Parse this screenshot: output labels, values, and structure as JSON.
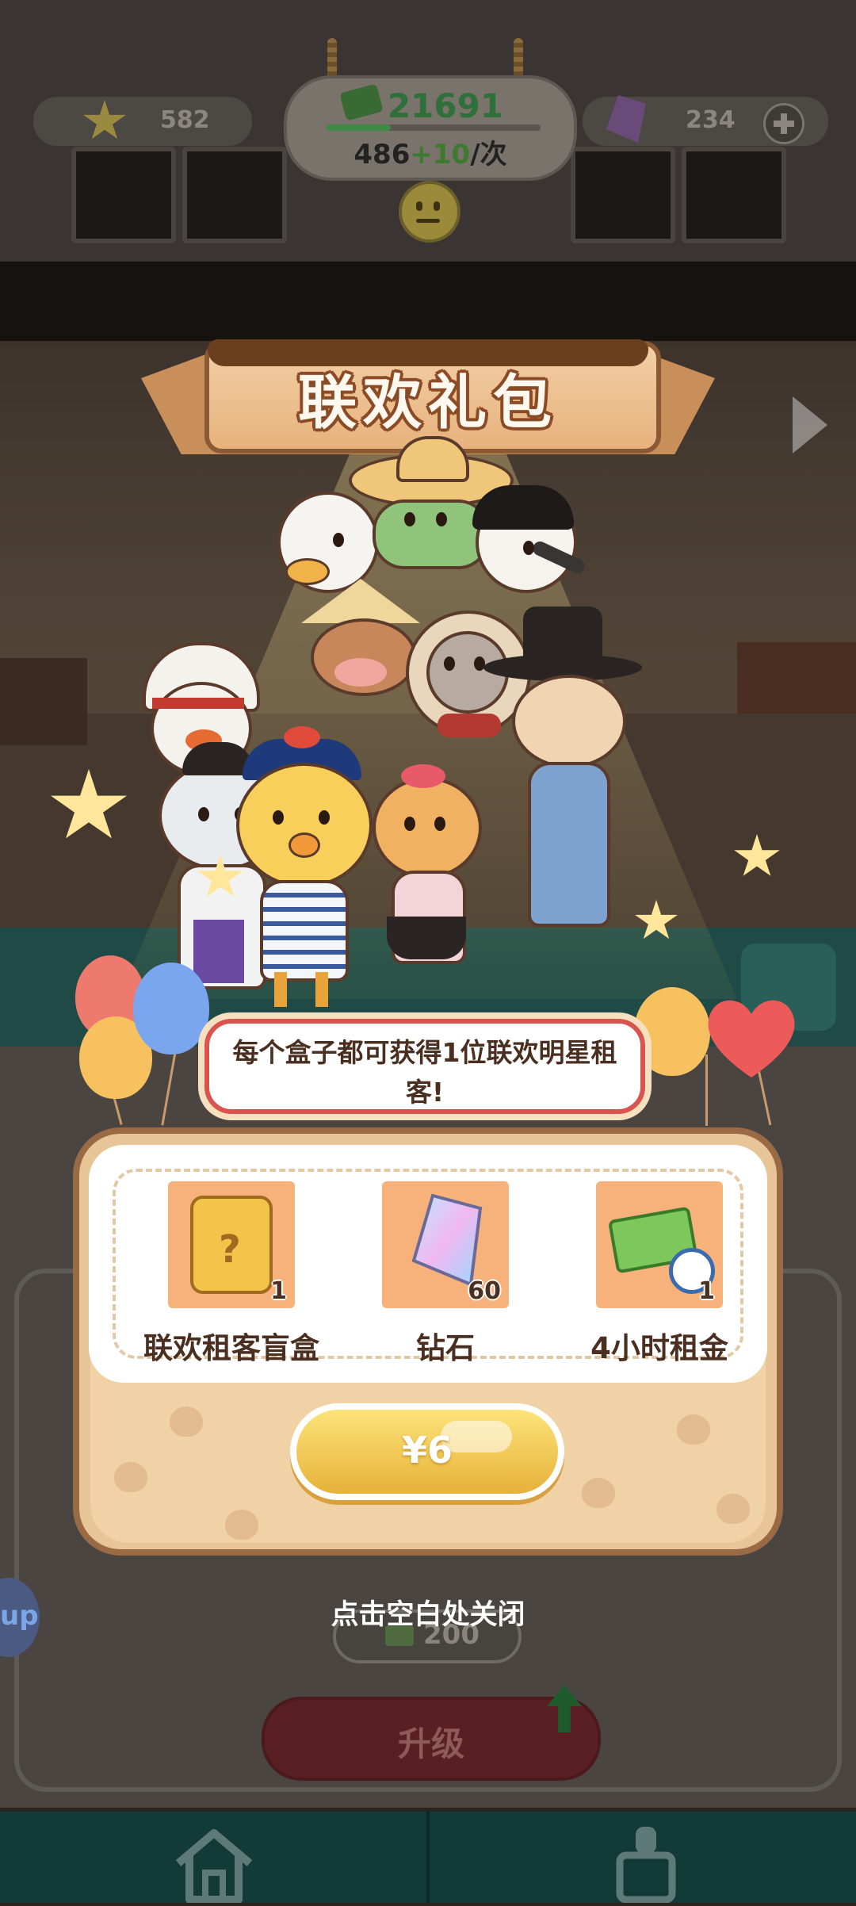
{
  "hud": {
    "stars": "582",
    "money": "21691",
    "money_progress": 0.3,
    "rate_base": "486",
    "rate_bonus": "+10",
    "rate_unit": "/次",
    "gems": "234",
    "add_icon": "plus-circle-icon"
  },
  "popup": {
    "title": "联欢礼包",
    "description": "每个盒子都可获得1位联欢明星租客!",
    "rewards": [
      {
        "label": "联欢租客盲盒",
        "count": "1",
        "icon": "mystery-box-icon"
      },
      {
        "label": "钻石",
        "count": "60",
        "icon": "diamond-icon"
      },
      {
        "label": "4小时租金",
        "count": "1",
        "icon": "cash-stack-clock-icon"
      }
    ],
    "price": "¥6",
    "close_hint": "点击空白处关闭"
  },
  "background": {
    "upgrade_cost": "200",
    "upgrade_label": "升级",
    "side_badge": "up"
  },
  "colors": {
    "banner": "#e7b27d",
    "buy_button": "#fde37a",
    "speech_border": "#d9534f",
    "reward_slot": "#f6b27a"
  }
}
